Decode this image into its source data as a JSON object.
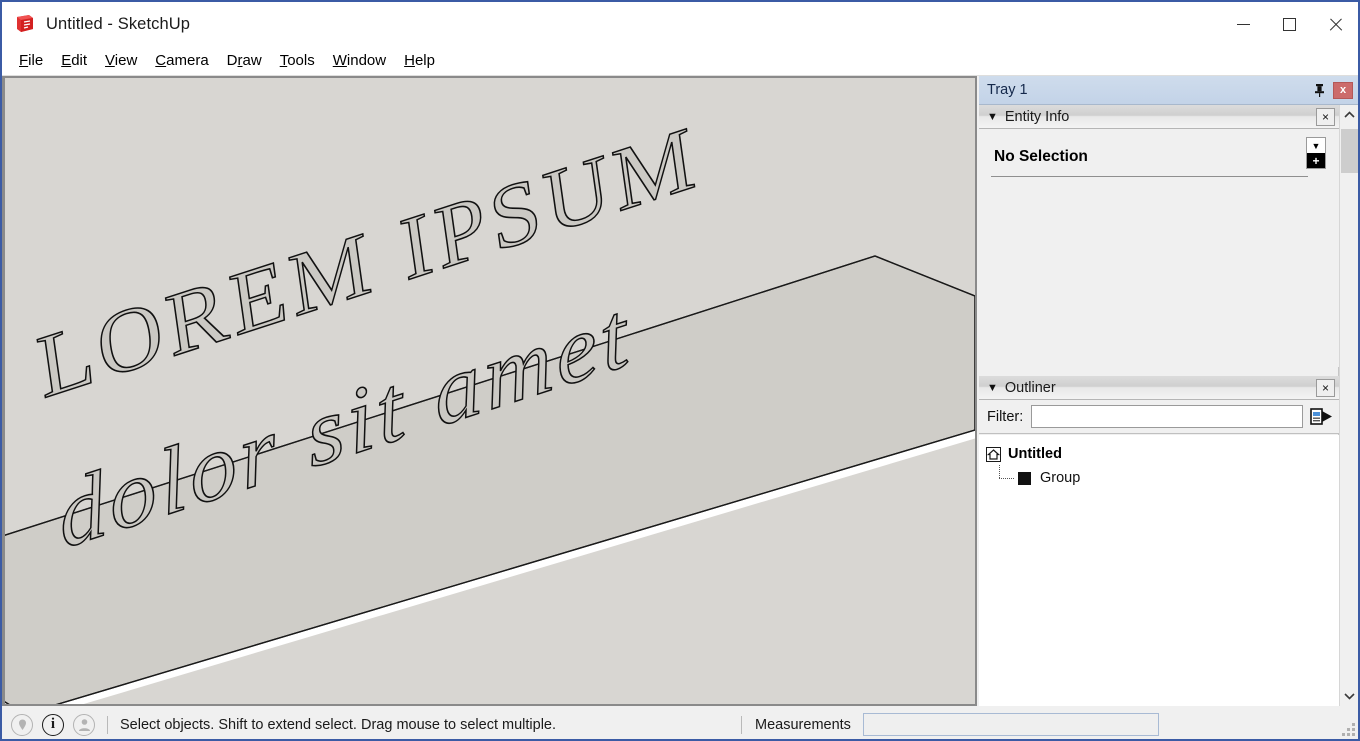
{
  "window": {
    "title": "Untitled - SketchUp",
    "logo_icon": "sketchup-logo-icon",
    "controls": {
      "minimize": "minimize-icon",
      "maximize": "maximize-icon",
      "close": "close-icon"
    }
  },
  "menubar": {
    "items": [
      {
        "label": "File",
        "mnemonic": "F"
      },
      {
        "label": "Edit",
        "mnemonic": "E"
      },
      {
        "label": "View",
        "mnemonic": "V"
      },
      {
        "label": "Camera",
        "mnemonic": "C"
      },
      {
        "label": "Draw",
        "mnemonic": "r"
      },
      {
        "label": "Tools",
        "mnemonic": "T"
      },
      {
        "label": "Window",
        "mnemonic": "W"
      },
      {
        "label": "Help",
        "mnemonic": "H"
      }
    ]
  },
  "viewport": {
    "background_color": "#d8d6d2",
    "slab_top_color": "#cfcdc8",
    "slab_edge_color": "#ffffff",
    "axis_red_color": "#8b0000",
    "model_text_line1": "LOREM IPSUM",
    "model_text_line2": "dolor sit amet"
  },
  "tray": {
    "title": "Tray 1",
    "pin_icon": "pin-icon",
    "close_icon": "close-icon",
    "close_label": "x",
    "panels": {
      "entity_info": {
        "title": "Entity Info",
        "caret": "▼",
        "close_label": "×",
        "status": "No Selection",
        "expand_icon": "expand-details-icon",
        "expand_caret": "▼",
        "expand_plus": "+"
      },
      "outliner": {
        "title": "Outliner",
        "caret": "▼",
        "close_label": "×",
        "filter_label": "Filter:",
        "filter_value": "",
        "filter_placeholder": "",
        "flyout_icon": "details-flyout-icon",
        "tree": [
          {
            "label": "Untitled",
            "icon": "home-icon",
            "level": 0
          },
          {
            "label": "Group",
            "icon": "group-swatch-icon",
            "level": 1
          }
        ]
      }
    },
    "scrollbar": {
      "up_arrow": "chevron-up-icon",
      "down_arrow": "chevron-down-icon"
    }
  },
  "statusbar": {
    "icons": [
      {
        "name": "geo-location-icon",
        "glyph": "⬤",
        "state": "dim"
      },
      {
        "name": "info-icon",
        "glyph": "i",
        "state": "on"
      },
      {
        "name": "account-icon",
        "glyph": "●",
        "state": "dim"
      }
    ],
    "hint": "Select objects. Shift to extend select. Drag mouse to select multiple.",
    "measurements_label": "Measurements",
    "measurements_value": "",
    "resize_grip": "resize-grip-icon"
  },
  "colors": {
    "titlebar_border": "#3b5ba5",
    "tray_header": "#c3d3e8",
    "close_red": "#cc6b6b",
    "panel_bg": "#f0f0f0"
  }
}
